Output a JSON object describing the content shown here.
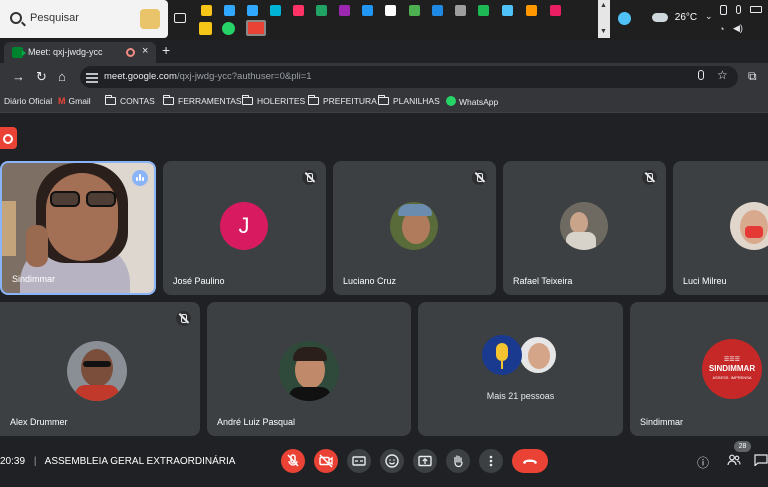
{
  "taskbar": {
    "search_placeholder": "Pesquisar",
    "temperature": "26°C",
    "pinned_apps": [
      {
        "name": "sticky-notes-icon",
        "color": "#f5c518"
      },
      {
        "name": "photoshop-icon",
        "color": "#31a8ff"
      },
      {
        "name": "photoshop-icon",
        "color": "#31a8ff"
      },
      {
        "name": "vector-app-icon",
        "color": "#00b4d8"
      },
      {
        "name": "indesign-icon",
        "color": "#ff3366"
      },
      {
        "name": "excel-icon",
        "color": "#21a366"
      },
      {
        "name": "app-icon",
        "color": "#9c27b0"
      },
      {
        "name": "app-icon",
        "color": "#2196f3"
      },
      {
        "name": "app-icon",
        "color": "#ffffff"
      },
      {
        "name": "app-icon",
        "color": "#4caf50"
      },
      {
        "name": "app-icon",
        "color": "#1e88e5"
      },
      {
        "name": "app-icon",
        "color": "#9e9e9e"
      },
      {
        "name": "spotify-icon",
        "color": "#1db954"
      },
      {
        "name": "app-icon",
        "color": "#4fc3f7"
      },
      {
        "name": "app-icon",
        "color": "#ff9800"
      },
      {
        "name": "app-icon",
        "color": "#e91e63"
      }
    ],
    "pinned_apps_row2": [
      {
        "name": "sticky-notes-icon",
        "color": "#f5c518"
      },
      {
        "name": "whatsapp-icon",
        "color": "#25d366"
      },
      {
        "name": "chrome-icon",
        "color": "#ea4335"
      }
    ]
  },
  "browser": {
    "tab_title": "Meet: qxj-jwdg-ycc",
    "url_host": "meet.google.com",
    "url_path": "/qxj-jwdg-ycc?authuser=0&pli=1",
    "bookmarks": [
      {
        "label": "Diário Oficial",
        "icon": "none"
      },
      {
        "label": "Gmail",
        "icon": "gmail-icon"
      },
      {
        "label": "CONTAS",
        "icon": "folder-icon"
      },
      {
        "label": "FERRAMENTAS",
        "icon": "folder-icon"
      },
      {
        "label": "HOLERITES",
        "icon": "folder-icon"
      },
      {
        "label": "PREFEITURA",
        "icon": "folder-icon"
      },
      {
        "label": "PLANILHAS",
        "icon": "folder-icon"
      },
      {
        "label": "WhatsApp",
        "icon": "whatsapp-icon"
      }
    ]
  },
  "meet": {
    "participants": [
      {
        "name": "Sindimmar",
        "speaking": true
      },
      {
        "name": "José Paulino",
        "initial": "J",
        "muted": true
      },
      {
        "name": "Luciano Cruz",
        "muted": true
      },
      {
        "name": "Rafael Teixeira",
        "muted": true
      },
      {
        "name": "Luci Milreu"
      },
      {
        "name": "Alex Drummer",
        "muted": true
      },
      {
        "name": "André Luiz Pasqual"
      },
      {
        "name": "Mais 21 pessoas"
      },
      {
        "name": "Sindimmar"
      }
    ],
    "logo_text": "SINDIMMAR",
    "logo_subtext": "ASSESS. IMPRENSA",
    "time": "20:39",
    "meeting_title": "ASSEMBLEIA GERAL EXTRAORDINÁRIA",
    "participant_count": "28",
    "colors": {
      "end_call": "#ea4335",
      "accent": "#8ab4f8",
      "tile": "#3c4043"
    }
  }
}
